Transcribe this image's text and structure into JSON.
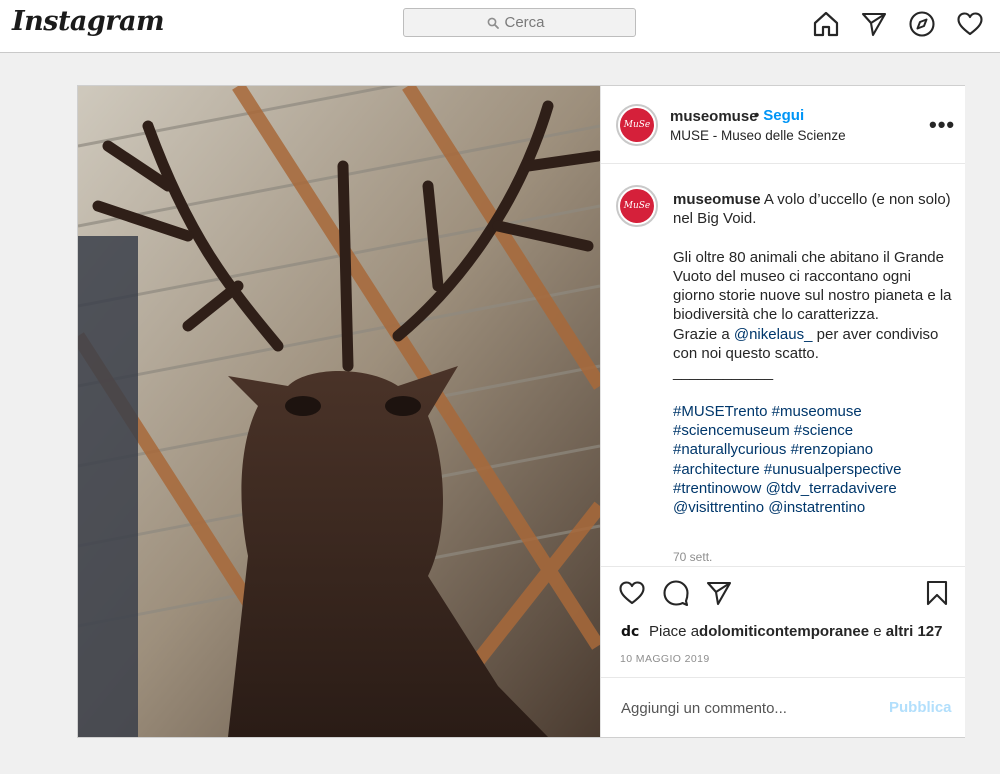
{
  "header": {
    "logo": "Instagram",
    "search_placeholder": "Cerca",
    "icons": [
      "home-icon",
      "send-icon",
      "explore-icon",
      "heart-icon"
    ]
  },
  "post": {
    "username": "museomuse",
    "follow_label": "Segui",
    "location": "MUSE - Museo delle Scienze",
    "more_label": "•••",
    "avatar_text": "MuSe",
    "caption": {
      "username": "museomuse",
      "intro": "A volo d’uccello (e non solo) nel Big Void.",
      "body": "Gli oltre 80 animali che abitano il Grande Vuoto del museo ci raccontano ogni giorno storie nuove sul nostro pianeta e la biodiversità che lo caratterizza.",
      "thanks_prefix": "Grazie a ",
      "thanks_mention": "@nikelaus_",
      "thanks_suffix": " per aver condiviso con noi questo scatto.",
      "separator": "____________",
      "tags": [
        "#MUSETrento",
        "#museomuse",
        "#sciencemuseum",
        "#science",
        "#naturallycurious",
        "#renzopiano",
        "#architecture",
        "#unusualperspective",
        "#trentinowow",
        "@tdv_terradavivere",
        "@visittrentino",
        "@instatrentino"
      ],
      "time": "70 sett."
    },
    "likes": {
      "prefix": "Piace a ",
      "user": "dolomiticontemporanee",
      "mid": " e ",
      "others": "altri 127"
    },
    "date": "10 MAGGIO 2019",
    "comment_placeholder": "Aggiungi un commento...",
    "publish_label": "Pubblica"
  },
  "colors": {
    "link": "#00376b",
    "follow": "#0095f6",
    "publish_disabled": "#b2dffc",
    "avatar": "#d5203a"
  }
}
